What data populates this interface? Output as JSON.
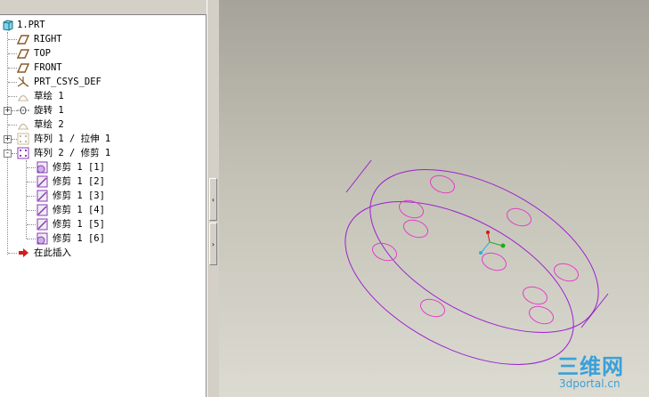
{
  "model_tree": {
    "items": [
      {
        "label": "1.PRT",
        "icon": "part-icon"
      },
      {
        "label": "RIGHT",
        "icon": "datum-plane-icon"
      },
      {
        "label": "TOP",
        "icon": "datum-plane-icon"
      },
      {
        "label": "FRONT",
        "icon": "datum-plane-icon"
      },
      {
        "label": "PRT_CSYS_DEF",
        "icon": "coordinate-system-icon"
      },
      {
        "label": "草绘 1",
        "icon": "sketch-icon"
      },
      {
        "label": "旋转 1",
        "icon": "revolve-icon",
        "expander": "+"
      },
      {
        "label": "草绘 2",
        "icon": "sketch-icon"
      },
      {
        "label": "阵列 1 / 拉伸 1",
        "icon": "pattern-icon",
        "expander": "+"
      },
      {
        "label": "阵列 2 / 修剪 1",
        "icon": "pattern-icon",
        "expander": "-"
      },
      {
        "label": "修剪 1 [1]",
        "icon": "trim-icon"
      },
      {
        "label": "修剪 1 [2]",
        "icon": "trim-icon"
      },
      {
        "label": "修剪 1 [3]",
        "icon": "trim-icon"
      },
      {
        "label": "修剪 1 [4]",
        "icon": "trim-icon"
      },
      {
        "label": "修剪 1 [5]",
        "icon": "trim-icon"
      },
      {
        "label": "修剪 1 [6]",
        "icon": "trim-icon"
      },
      {
        "label": "在此插入",
        "icon": "insert-here-arrow-icon"
      }
    ]
  },
  "splitter": {
    "collapse_label": "‹",
    "expand_label": "›"
  },
  "watermark": {
    "brand": "三维网",
    "site": "3dportal.cn"
  },
  "colors": {
    "model_outline": "#9b1fd1",
    "holes": "#e040c8",
    "watermark": "#3aa0d8"
  }
}
